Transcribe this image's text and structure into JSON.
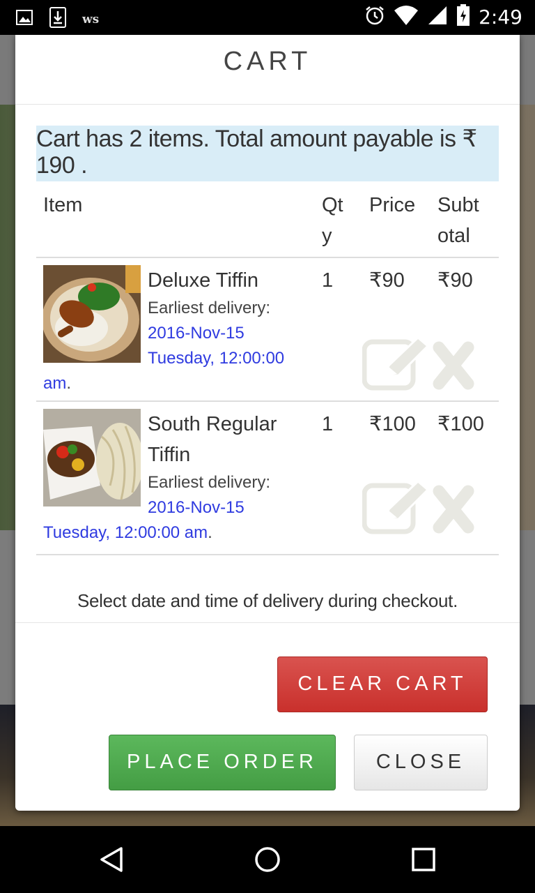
{
  "status_bar": {
    "carrier_label": "ws",
    "time": "2:49",
    "icons": [
      "image-icon",
      "download-icon",
      "alarm-icon",
      "wifi-icon",
      "signal-icon",
      "battery-icon"
    ]
  },
  "dialog": {
    "title": "CART",
    "summary": "Cart has 2 items. Total amount payable is ₹ 190 .",
    "columns": [
      "Item",
      "Qt y",
      "Price",
      "Subt otal"
    ],
    "items": [
      {
        "name": "Deluxe Tiffin",
        "delivery_label": "Earliest delivery: ",
        "delivery_date": "2016-Nov-15 Tuesday, 12:00:00 am",
        "delivery_suffix": ".",
        "qty": "1",
        "price": "₹90",
        "subtotal": "₹90",
        "image": "chicken-rice-plate"
      },
      {
        "name": "South Regular Tiffin",
        "delivery_label": "Earliest delivery: ",
        "delivery_date": "2016-Nov-15 Tuesday, 12:00:00 am",
        "delivery_suffix": ".",
        "qty": "1",
        "price": "₹100",
        "subtotal": "₹100",
        "image": "curry-noodles-bowl"
      }
    ],
    "note": "Select date and time of delivery during checkout.",
    "buttons": {
      "clear": "CLEAR CART",
      "place": "PLACE ORDER",
      "close": "CLOSE"
    },
    "colors": {
      "summary_bg": "#d9edf7",
      "link": "#2f3be0",
      "clear": "#d9534f",
      "place": "#5cb85c"
    }
  },
  "nav_bar": {
    "icons": [
      "back-icon",
      "home-icon",
      "recents-icon"
    ]
  }
}
